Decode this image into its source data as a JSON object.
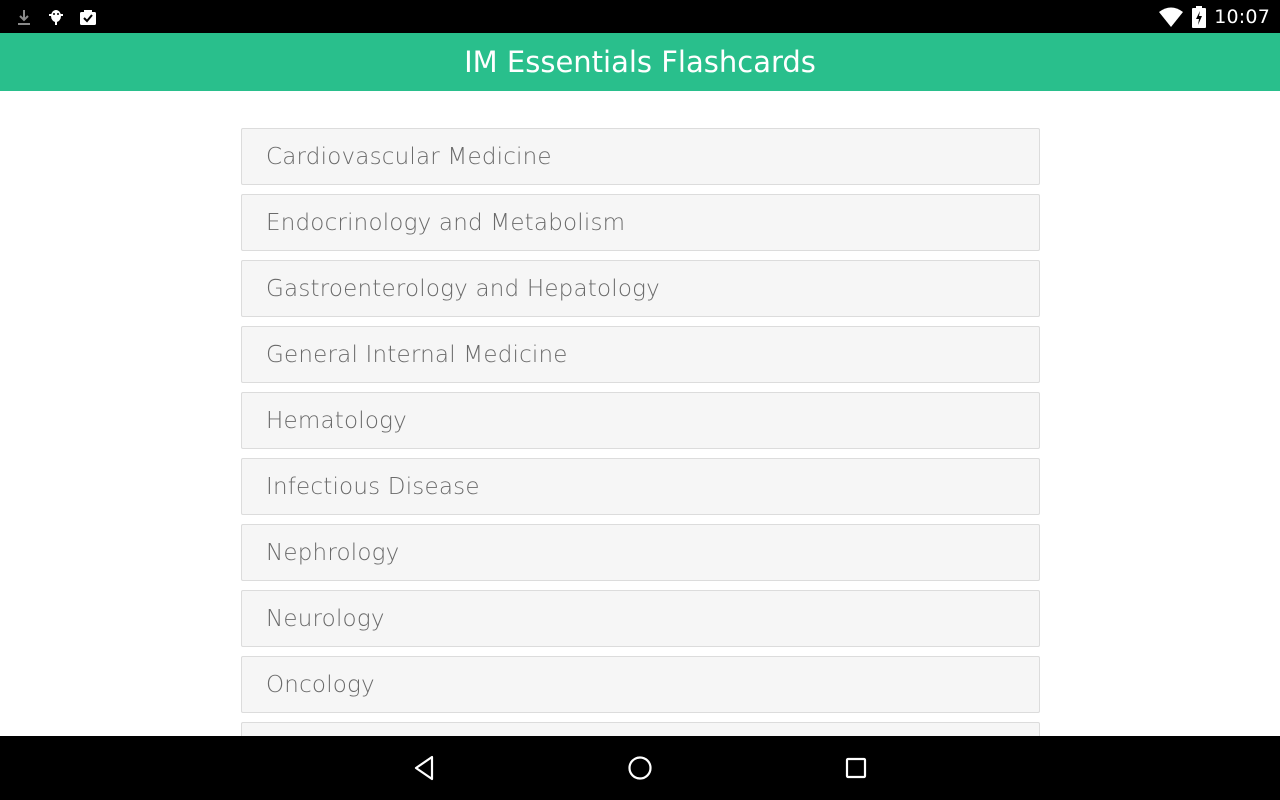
{
  "status_bar": {
    "time": "10:07",
    "left_icons": [
      "download-icon",
      "android-debug-icon",
      "task-check-icon"
    ],
    "right_icons": [
      "wifi-icon",
      "battery-icon"
    ]
  },
  "app_bar": {
    "title": "IM Essentials Flashcards",
    "background_color": "#29bf8c"
  },
  "topics": [
    {
      "label": "Cardiovascular Medicine"
    },
    {
      "label": "Endocrinology and Metabolism"
    },
    {
      "label": "Gastroenterology and Hepatology"
    },
    {
      "label": "General Internal Medicine"
    },
    {
      "label": "Hematology"
    },
    {
      "label": "Infectious Disease"
    },
    {
      "label": "Nephrology"
    },
    {
      "label": "Neurology"
    },
    {
      "label": "Oncology"
    },
    {
      "label": ""
    }
  ],
  "nav_bar": {
    "buttons": [
      "back-icon",
      "home-icon",
      "recents-icon"
    ]
  }
}
